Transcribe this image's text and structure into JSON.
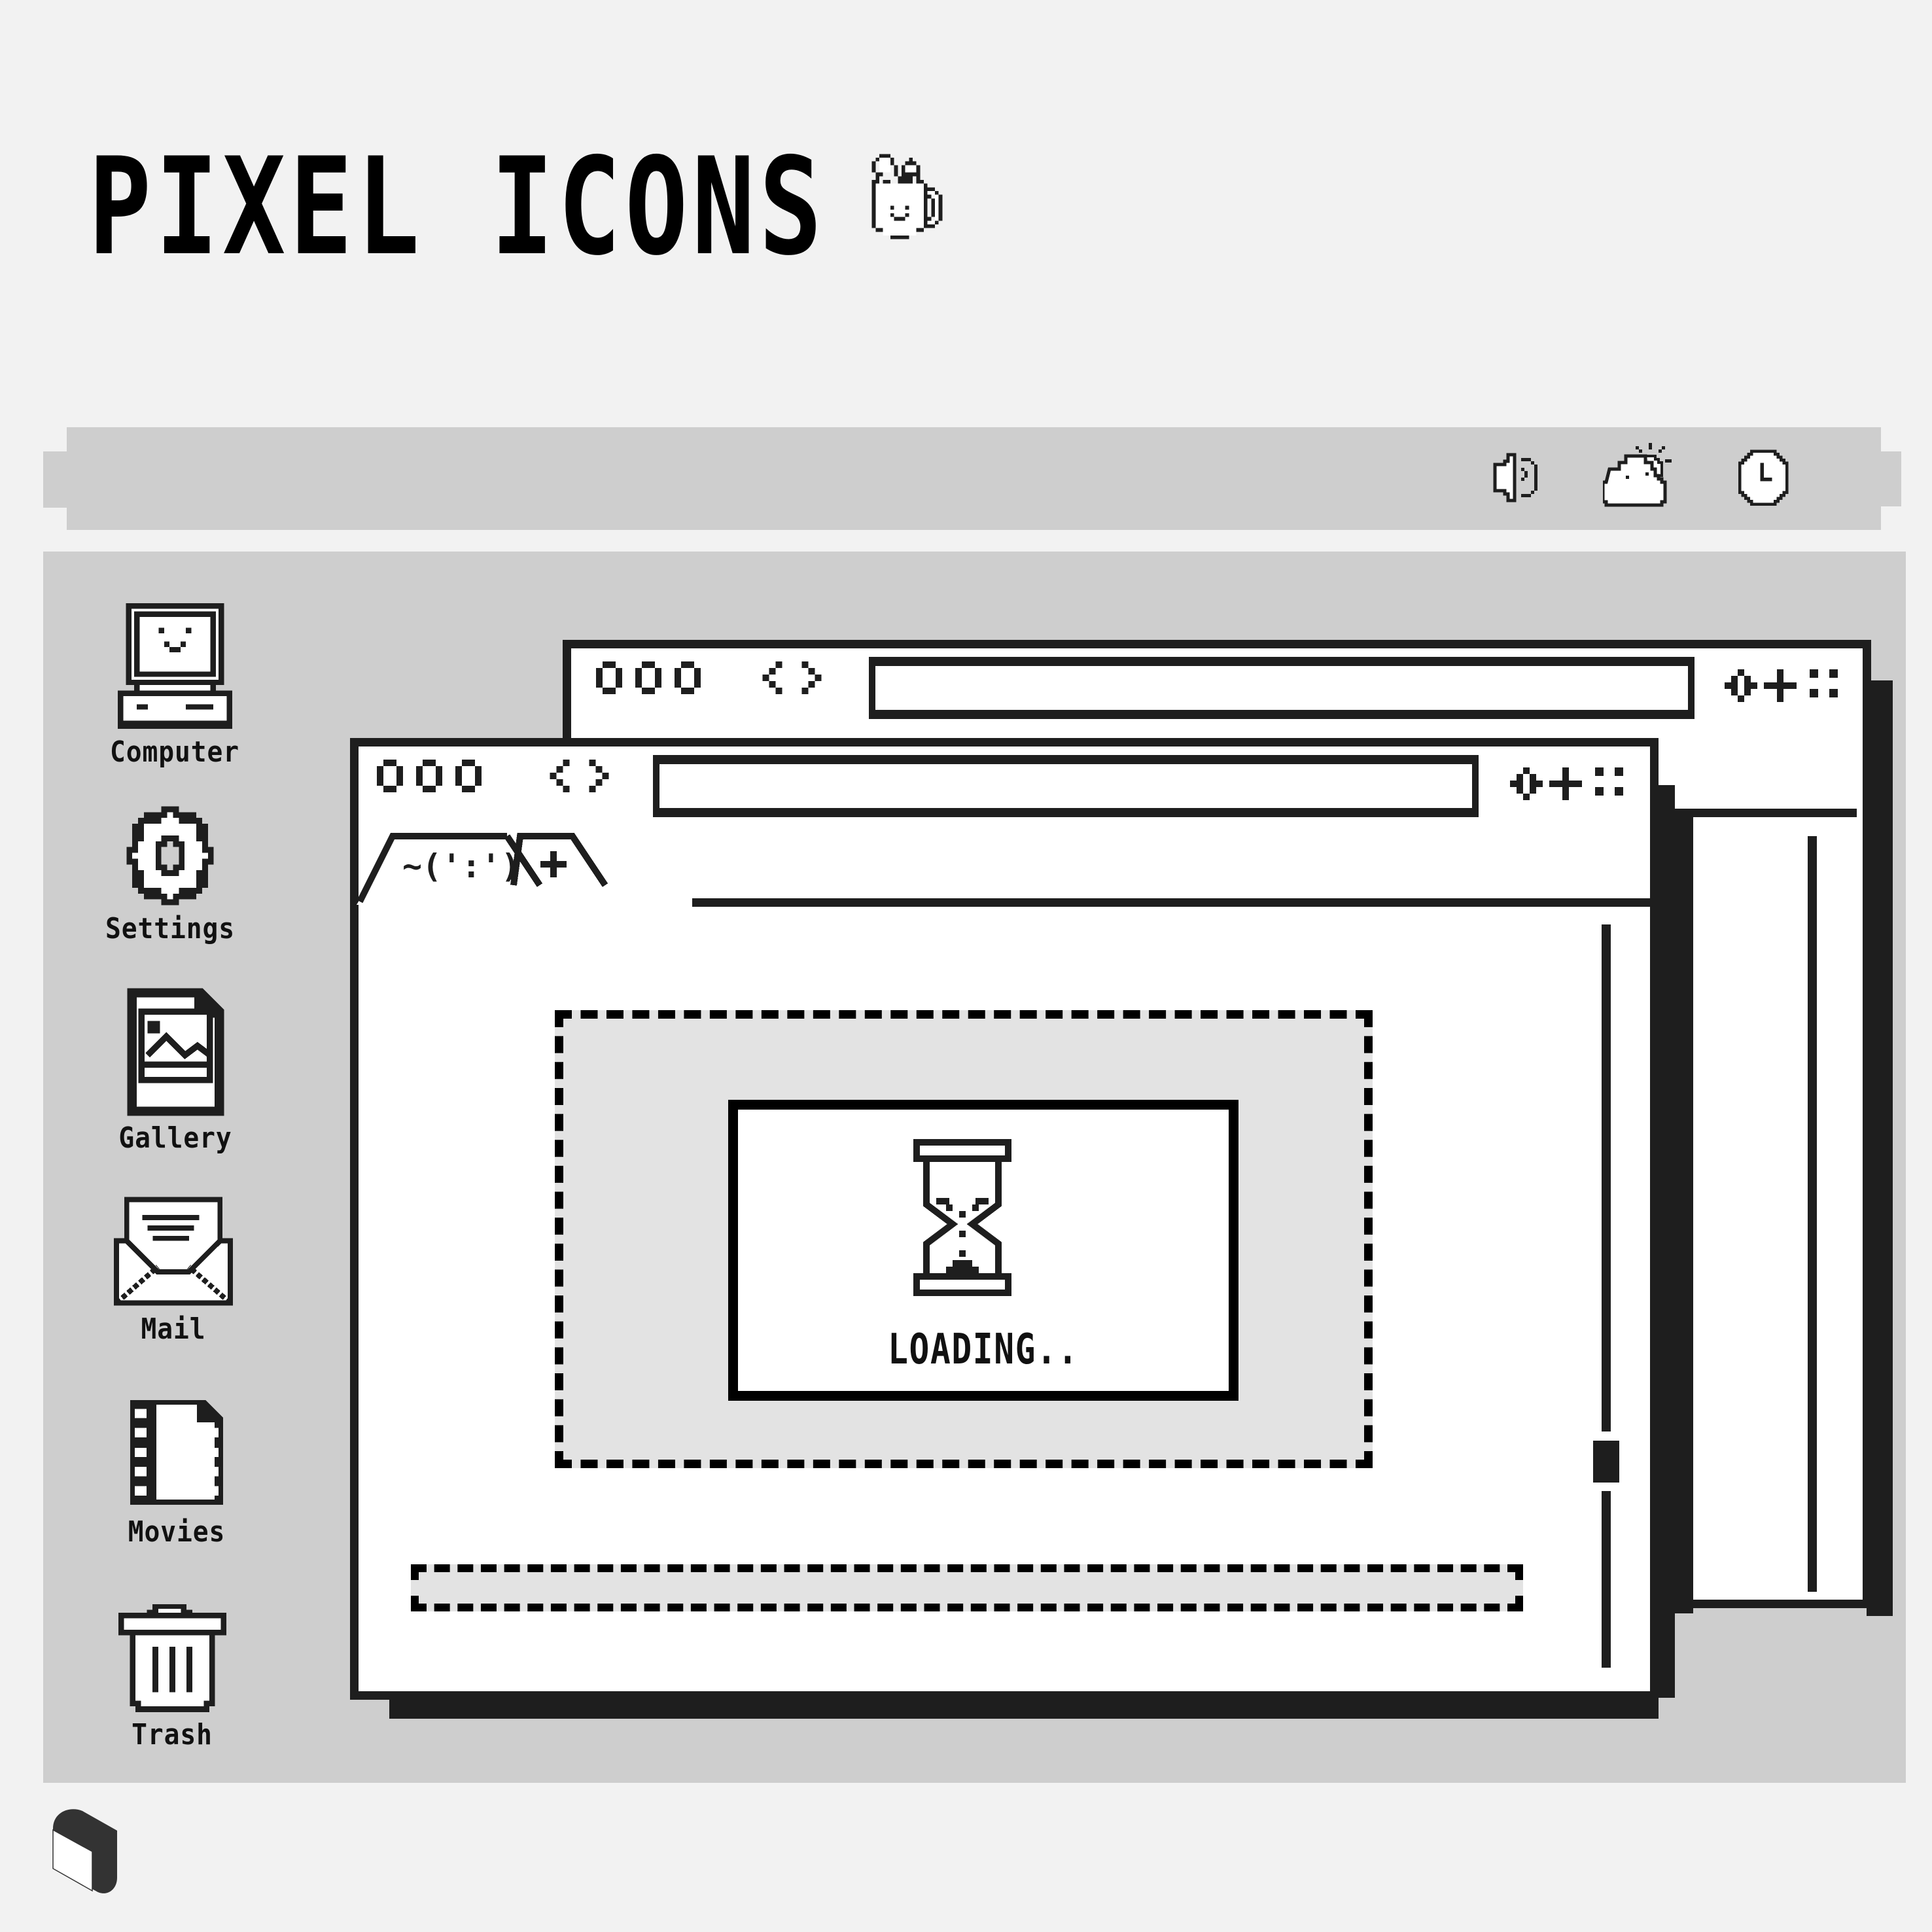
{
  "header": {
    "title": "PIXEL ICONS",
    "mascot_icon": "coffee-mug-icon"
  },
  "menu_bar": {
    "tray": [
      {
        "icon": "volume-icon"
      },
      {
        "icon": "partly-cloudy-icon"
      },
      {
        "icon": "clock-icon"
      }
    ]
  },
  "desktop": {
    "items": [
      {
        "label": "Computer",
        "icon": "computer-icon"
      },
      {
        "label": "Settings",
        "icon": "gear-icon"
      },
      {
        "label": "Gallery",
        "icon": "image-file-icon"
      },
      {
        "label": "Mail",
        "icon": "envelope-icon"
      },
      {
        "label": "Movies",
        "icon": "film-file-icon"
      },
      {
        "label": "Trash",
        "icon": "trash-icon"
      }
    ]
  },
  "front_window": {
    "tabs": [
      {
        "label": "~(':')",
        "active": true
      },
      {
        "label": "+",
        "active": false
      }
    ],
    "address_value": "",
    "dialog": {
      "icon": "hourglass-icon",
      "text": "LOADING.."
    },
    "input_value": ""
  },
  "back_window": {
    "address_value": ""
  },
  "colors": {
    "page_bg": "#f2f2f2",
    "panel_gray": "#cecece",
    "content_gray": "#e3e3e3",
    "ink": "#1e1e1e",
    "window_bg": "#ffffff"
  }
}
